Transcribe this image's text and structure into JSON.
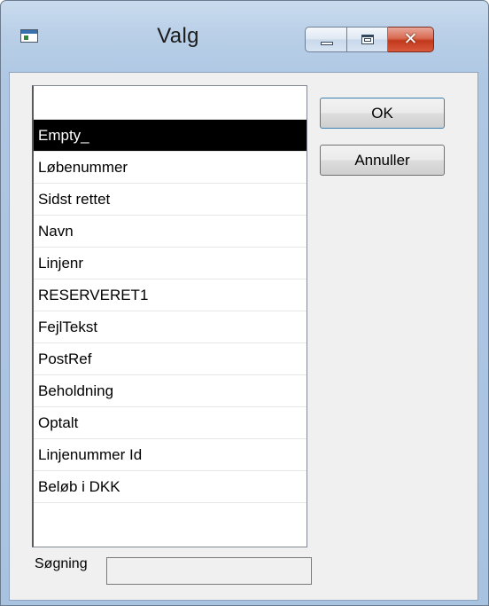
{
  "window": {
    "title": "Valg",
    "caption_buttons": {
      "minimize": "",
      "maximize": "",
      "close": "✕"
    }
  },
  "list": {
    "selected_index": 0,
    "items": [
      "Empty_",
      "Løbenummer",
      "Sidst rettet",
      "Navn",
      "Linjenr",
      "RESERVERET1",
      "FejlTekst",
      "PostRef",
      "Beholdning",
      "Optalt",
      "Linjenummer Id",
      "Beløb i DKK"
    ]
  },
  "buttons": {
    "ok_label": "OK",
    "cancel_label": "Annuller"
  },
  "search": {
    "label": "Søgning",
    "value": ""
  },
  "colors": {
    "selection_bg": "#000000",
    "selection_fg": "#ffffff",
    "close_button": "#c7432a"
  }
}
